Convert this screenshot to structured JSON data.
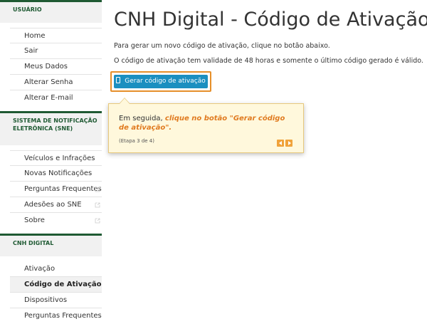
{
  "sidebar": {
    "usuario": {
      "header": "USUÁRIO",
      "items": [
        "Home",
        "Sair",
        "Meus Dados",
        "Alterar Senha",
        "Alterar E-mail"
      ]
    },
    "sne": {
      "header": "SISTEMA DE NOTIFICAÇÃO ELETRÔNICA (SNE)",
      "items": [
        "Veículos e Infrações",
        "Novas Notificações",
        "Perguntas Frequentes",
        "Adesões ao SNE",
        "Sobre"
      ]
    },
    "cnh": {
      "header": "CNH DIGITAL",
      "items": [
        "Ativação",
        "Código de Ativação",
        "Dispositivos",
        "Perguntas Frequentes"
      ]
    }
  },
  "main": {
    "title": "CNH Digital - Código de Ativação",
    "para1": "Para gerar um novo código de ativação, clique no botão abaixo.",
    "para2": "O código de ativação tem validade de 48 horas e somente o último código gerado é válido.",
    "button_label": "Gerar código de ativação"
  },
  "tooltip": {
    "text_prefix": "Em seguida, ",
    "text_emphasis": "clique no botão \"Gerar código de ativação\".",
    "step": "(Etapa 3 de 4)"
  },
  "colors": {
    "accent_green": "#1f5a33",
    "button_blue": "#1b8fc0",
    "highlight_orange": "#e68f2a"
  }
}
